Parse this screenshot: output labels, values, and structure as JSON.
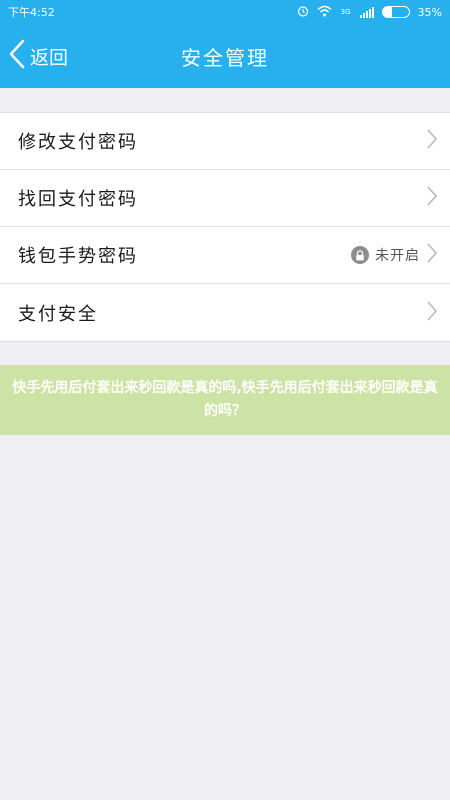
{
  "status_bar": {
    "time": "下午4:52",
    "network": "3G",
    "battery_text": "35%",
    "battery_level": 0.35
  },
  "nav": {
    "back_label": "返回",
    "title": "安全管理"
  },
  "menu": [
    {
      "label": "修改支付密码",
      "status": ""
    },
    {
      "label": "找回支付密码",
      "status": ""
    },
    {
      "label": "钱包手势密码",
      "status": "未开启"
    },
    {
      "label": "支付安全",
      "status": ""
    }
  ],
  "banner": {
    "text": "快手先用后付套出来秒回款是真的吗,快手先用后付套出来秒回款是真的吗？"
  },
  "colors": {
    "primary": "#26b0ee",
    "background": "#efeff4",
    "banner": "#cde3a5"
  }
}
